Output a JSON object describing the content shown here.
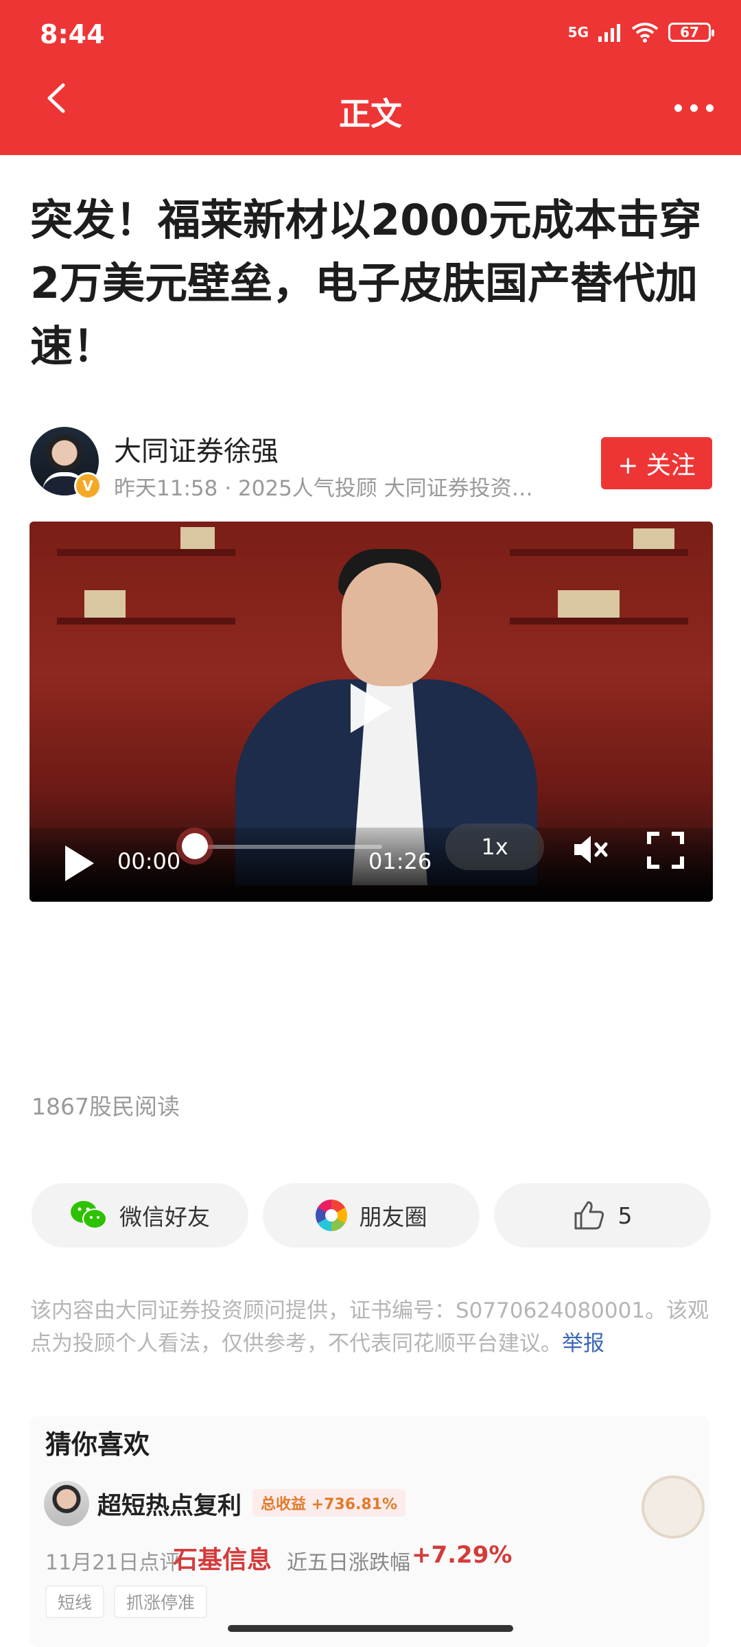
{
  "status_bar": {
    "time": "8:44",
    "network": "5G",
    "battery": "67"
  },
  "nav": {
    "title": "正文"
  },
  "article": {
    "title": "突发！福莱新材以2000元成本击穿2万美元壁垒，电子皮肤国产替代加速！",
    "author": "大同证券徐强",
    "meta": "昨天11:58 · 2025人气投顾 大同证券投资…",
    "follow_label": "+ 关注"
  },
  "video": {
    "current_time": "00:00",
    "duration": "01:26",
    "speed": "1x",
    "progress": 0
  },
  "reads": "1867股民阅读",
  "share": {
    "wechat_label": "微信好友",
    "moments_label": "朋友圈",
    "like_count": "5"
  },
  "disclaimer": {
    "text": "该内容由大同证券投资顾问提供，证书编号：S0770624080001。该观点为投顾个人看法，仅供参考，不代表同花顺平台建议。",
    "report_label": "举报"
  },
  "recommend": {
    "title": "猜你喜欢",
    "name": "超短热点复利",
    "profit_badge": "总收益 +736.81%",
    "date": "11月21日点评",
    "stock": "石基信息",
    "change_label": "近五日涨跌幅",
    "change_value": "+7.29%",
    "tags": [
      "短线",
      "抓涨停准"
    ]
  },
  "icons": [
    "back-icon",
    "more-icon",
    "verified-icon",
    "play-icon",
    "mute-icon",
    "fullscreen-icon",
    "wechat-icon",
    "moments-icon",
    "thumbs-up-icon"
  ],
  "colors": {
    "brand_red": "#ee3535",
    "link_blue": "#3a66b8",
    "profit_orange": "#e07b2a"
  }
}
